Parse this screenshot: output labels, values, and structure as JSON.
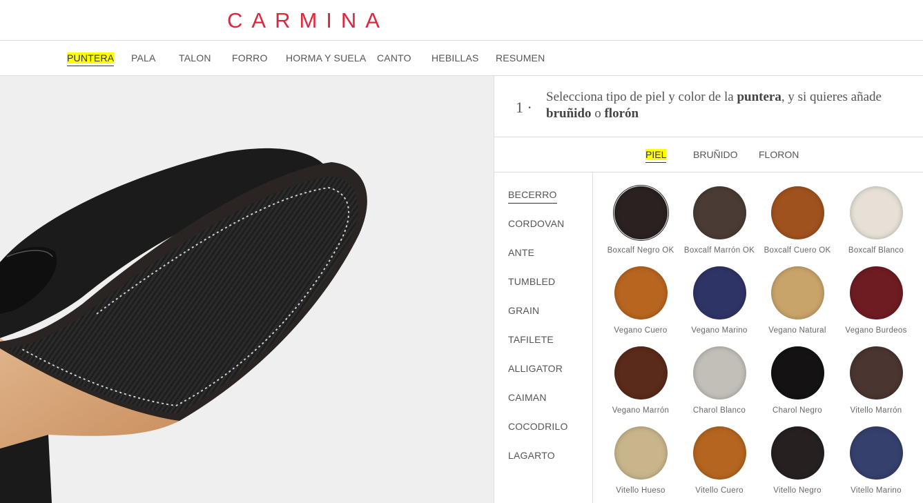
{
  "brand": {
    "name": "CARMINA",
    "color": "#e0263d"
  },
  "nav": {
    "items": [
      {
        "label": "PUNTERA",
        "active": true
      },
      {
        "label": "PALA"
      },
      {
        "label": "TALON"
      },
      {
        "label": "FORRO"
      },
      {
        "label": "HORMA Y SUELA"
      },
      {
        "label": "CANTO"
      },
      {
        "label": "HEBILLAS"
      },
      {
        "label": "RESUMEN"
      }
    ]
  },
  "step": {
    "number": "1 ·",
    "text_parts": [
      "Selecciona tipo de piel y color de la ",
      "puntera",
      ", y si quieres añade ",
      "bruñido",
      " o ",
      "florón"
    ]
  },
  "subtabs": [
    {
      "label": "PIEL",
      "active": true
    },
    {
      "label": "BRUÑIDO"
    },
    {
      "label": "FLORON"
    }
  ],
  "leather_types": [
    "BECERRO",
    "CORDOVAN",
    "ANTE",
    "TUMBLED",
    "GRAIN",
    "TAFILETE",
    "ALLIGATOR",
    "CAIMAN",
    "COCODRILO",
    "LAGARTO"
  ],
  "swatches": [
    {
      "name": "Boxcalf Negro OK",
      "color": "#2a2220",
      "selected": true
    },
    {
      "name": "Boxcalf Marrón OK",
      "color": "#4a3c34"
    },
    {
      "name": "Boxcalf Cuero OK",
      "color": "#a0521e"
    },
    {
      "name": "Boxcalf Blanco",
      "color": "#e6e0d6"
    },
    {
      "name": "Vegano Cuero",
      "color": "#b8651f"
    },
    {
      "name": "Vegano Marino",
      "color": "#2f3466"
    },
    {
      "name": "Vegano Natural",
      "color": "#c9a46a"
    },
    {
      "name": "Vegano Burdeos",
      "color": "#6e1c22"
    },
    {
      "name": "Vegano Marrón",
      "color": "#5a2a1a"
    },
    {
      "name": "Charol Blanco",
      "color": "#c2bfb8"
    },
    {
      "name": "Charol Negro",
      "color": "#141212"
    },
    {
      "name": "Vitello Marrón",
      "color": "#4a3530"
    },
    {
      "name": "Vitello Hueso",
      "color": "#c8b58c"
    },
    {
      "name": "Vitello Cuero",
      "color": "#b5651f"
    },
    {
      "name": "Vitello Negro",
      "color": "#262020"
    },
    {
      "name": "Vitello Marino",
      "color": "#35406c"
    }
  ]
}
